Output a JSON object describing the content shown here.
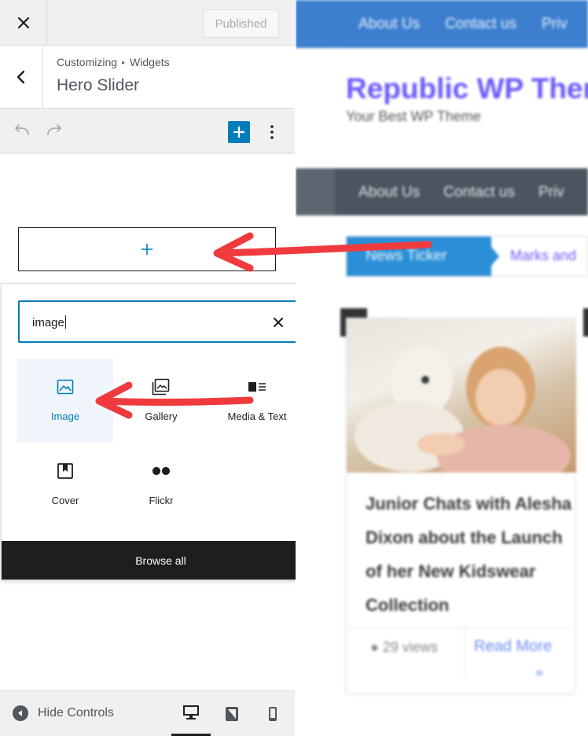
{
  "colors": {
    "accent": "#007cba",
    "arrow": "#ef3b3e",
    "nav_bar": "#3d7fcf",
    "site_title": "#6a5af9"
  },
  "topbar": {
    "close_icon": "close-icon",
    "published_label": "Published"
  },
  "section": {
    "breadcrumb_root": "Customizing",
    "breadcrumb_current": "Widgets",
    "title": "Hero Slider"
  },
  "toolbar": {
    "undo_icon": "undo-icon",
    "redo_icon": "redo-icon",
    "add_icon": "plus-icon",
    "more_icon": "more-vertical-icon"
  },
  "inserter": {
    "search_value": "image",
    "results": [
      {
        "label": "Image",
        "icon": "image-icon",
        "selected": true
      },
      {
        "label": "Gallery",
        "icon": "gallery-icon",
        "selected": false
      },
      {
        "label": "Media & Text",
        "icon": "media-text-icon",
        "selected": false
      },
      {
        "label": "Cover",
        "icon": "cover-icon",
        "selected": false
      },
      {
        "label": "Flickr",
        "icon": "flickr-icon",
        "selected": false
      }
    ],
    "browse_all_label": "Browse all"
  },
  "footer": {
    "hide_controls_label": "Hide Controls",
    "devices": [
      "desktop",
      "tablet",
      "mobile"
    ],
    "active_device": "desktop"
  },
  "preview": {
    "top_nav": [
      "About Us",
      "Contact us",
      "Priv"
    ],
    "site_title": "Republic WP Ther",
    "tagline": "Your Best WP Theme",
    "main_nav": [
      "About Us",
      "Contact us",
      "Priv"
    ],
    "ticker_label": "News Ticker",
    "ticker_text": "Marks and",
    "post_title": "Junior Chats with Alesha Dixon about the Launch of her New Kidswear Collection",
    "views": "29 views",
    "read_more": "Read More",
    "read_more_arrow": "»"
  }
}
